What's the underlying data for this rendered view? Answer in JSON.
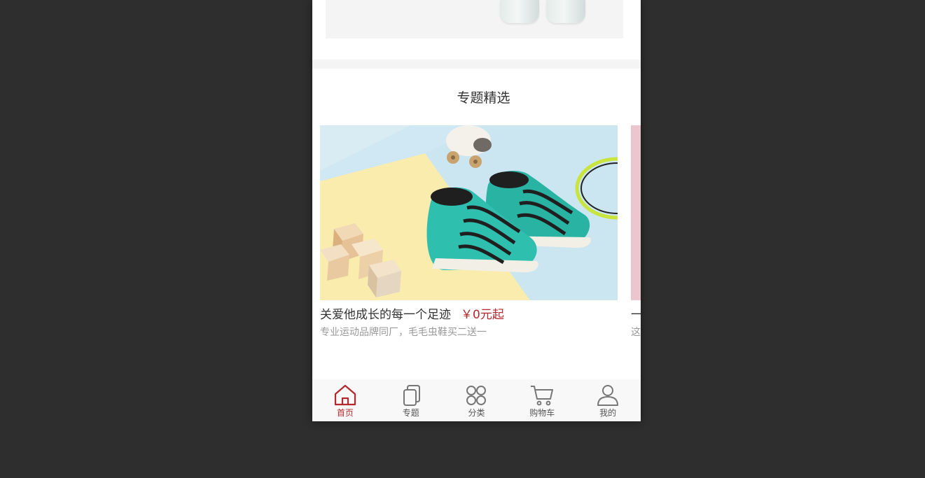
{
  "section": {
    "title": "专题精选"
  },
  "topics": [
    {
      "title": "关爱他成长的每一个足迹",
      "price": "￥0元起",
      "desc": "专业运动品牌同厂，毛毛虫鞋买二送一"
    },
    {
      "title": "一",
      "price": "",
      "desc": "这"
    }
  ],
  "tabs": [
    {
      "label": "首页",
      "icon": "home-icon",
      "active": true
    },
    {
      "label": "专题",
      "icon": "topic-icon",
      "active": false
    },
    {
      "label": "分类",
      "icon": "category-icon",
      "active": false
    },
    {
      "label": "购物车",
      "icon": "cart-icon",
      "active": false
    },
    {
      "label": "我的",
      "icon": "user-icon",
      "active": false
    }
  ],
  "colors": {
    "accent": "#b4282d",
    "page_bg": "#2e2e2e",
    "divider": "#f4f4f4",
    "muted_text": "#999999"
  }
}
